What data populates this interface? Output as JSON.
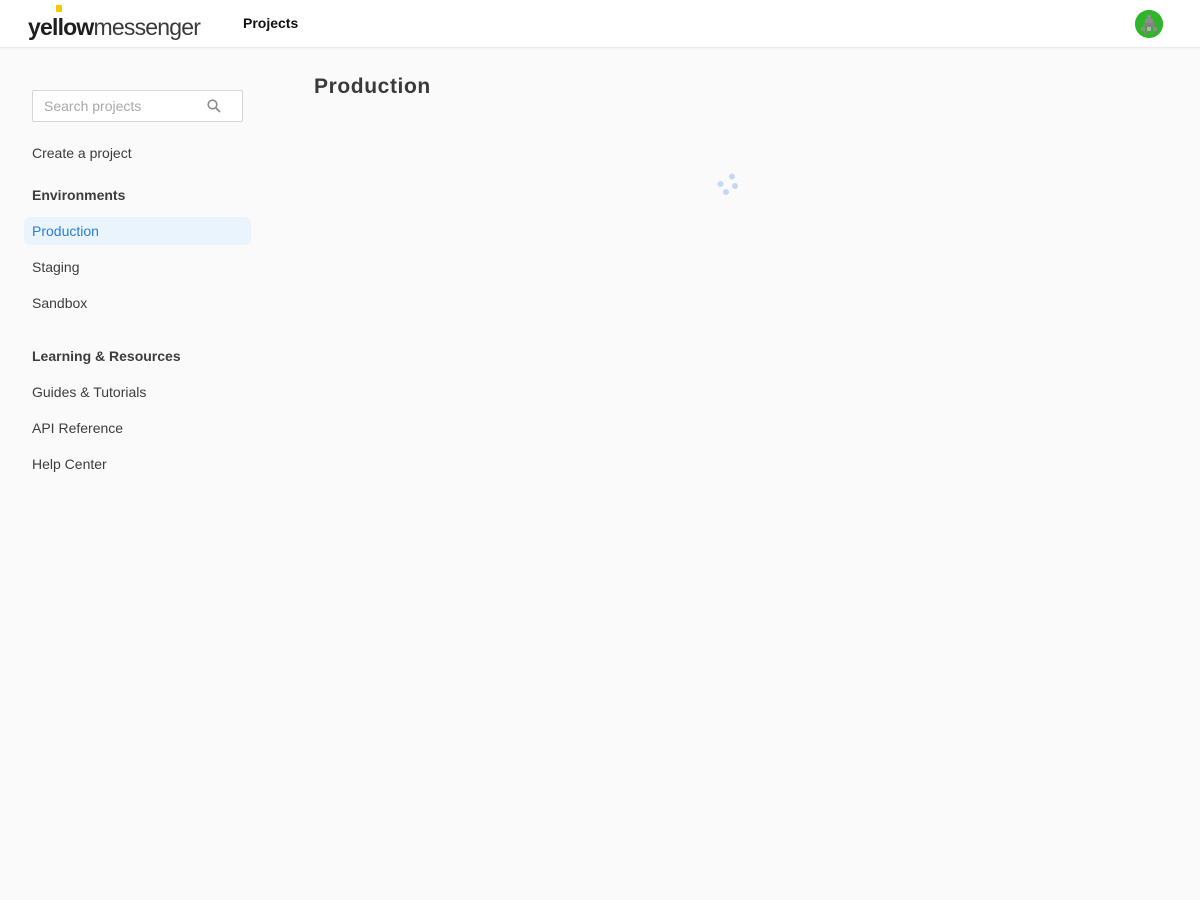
{
  "header": {
    "logo_bold": "yellow",
    "logo_light": "messenger",
    "nav_projects": "Projects",
    "avatar_icon": "user-avatar-icon",
    "avatar_color": "#2fb52a"
  },
  "sidebar": {
    "search": {
      "placeholder": "Search projects",
      "value": "",
      "icon": "search-icon"
    },
    "create_project": "Create a project",
    "environments_heading": "Environments",
    "environments": [
      {
        "label": "Production",
        "active": true
      },
      {
        "label": "Staging",
        "active": false
      },
      {
        "label": "Sandbox",
        "active": false
      }
    ],
    "resources_heading": "Learning & Resources",
    "resources": [
      {
        "label": "Guides & Tutorials"
      },
      {
        "label": "API Reference"
      },
      {
        "label": "Help Center"
      }
    ]
  },
  "main": {
    "title": "Production",
    "loading_icon": "loading-spinner-icon"
  },
  "colors": {
    "accent": "#2b7fd4",
    "active_bg": "#eaf4fd",
    "logo_yellow": "#f6c700",
    "spinner": "#c5d7f5"
  }
}
